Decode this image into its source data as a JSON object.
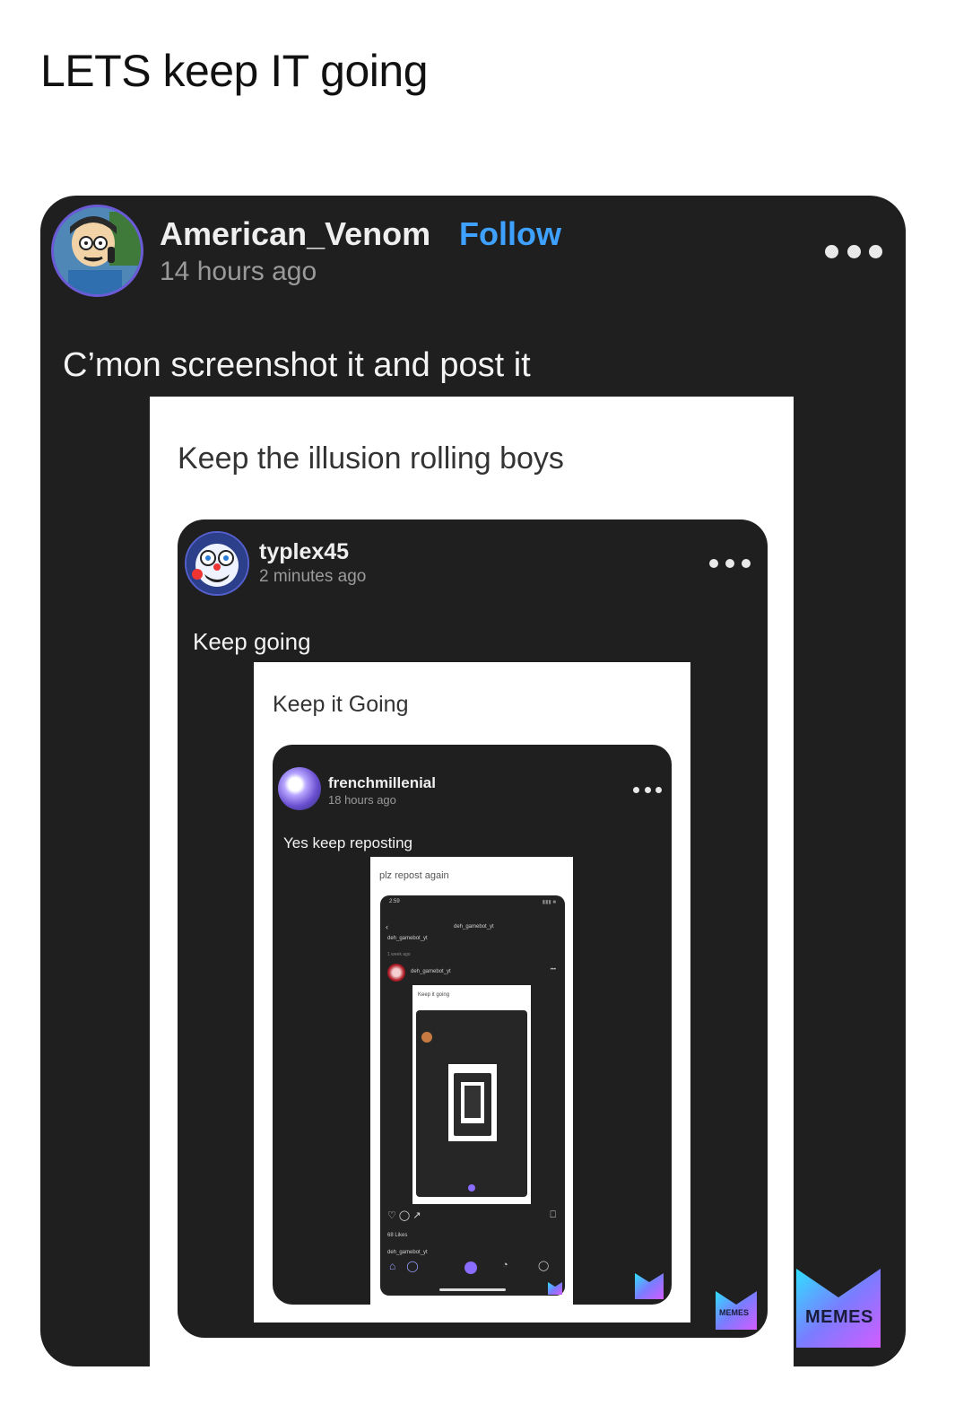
{
  "caption": "LETS keep IT going",
  "post": {
    "username": "American_Venom",
    "follow_label": "Follow",
    "time": "14 hours ago",
    "text": "C’mon screenshot it and post it"
  },
  "frame1": {
    "caption": "Keep the illusion rolling boys"
  },
  "post2": {
    "username": "typlex45",
    "time": "2 minutes ago",
    "text": "Keep going"
  },
  "frame2": {
    "caption": "Keep it Going"
  },
  "post3": {
    "username": "frenchmillenial",
    "time": "18 hours ago",
    "text": "Yes keep reposting"
  },
  "frame3": {
    "caption": "plz repost again"
  },
  "phone": {
    "status_time": "2:59",
    "header_title": "deh_gamebot_yt",
    "profile_name": "deh_gamebot_yt",
    "profile_time": "1 week ago",
    "post_user": "deh_gamebot_yt",
    "inner_caption": "Keep it going",
    "likes": "68 Likes",
    "caption_user": "deh_gamebot_yt"
  },
  "watermark": {
    "text": "MEMES"
  },
  "colors": {
    "card_bg": "#1f1f1f",
    "follow": "#3ea1ff",
    "page_bg": "#ffffff"
  }
}
